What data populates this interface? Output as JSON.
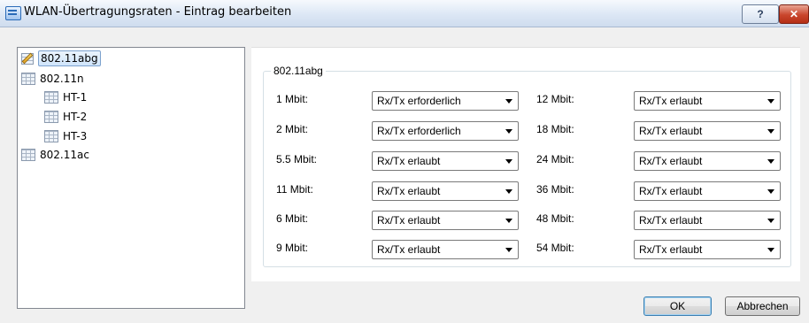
{
  "window": {
    "title": "WLAN-Übertragungsraten - Eintrag bearbeiten",
    "help_label": "?",
    "close_label": "✕"
  },
  "tree": {
    "items": [
      {
        "label": "802.11abg",
        "selected": true
      },
      {
        "label": "802.11n"
      },
      {
        "label": "HT-1"
      },
      {
        "label": "HT-2"
      },
      {
        "label": "HT-3"
      },
      {
        "label": "802.11ac"
      }
    ]
  },
  "group": {
    "title": "802.11abg"
  },
  "rates": {
    "left": [
      {
        "label": "1 Mbit:",
        "value": "Rx/Tx erforderlich"
      },
      {
        "label": "2 Mbit:",
        "value": "Rx/Tx erforderlich"
      },
      {
        "label": "5.5 Mbit:",
        "value": "Rx/Tx erlaubt"
      },
      {
        "label": "11 Mbit:",
        "value": "Rx/Tx erlaubt"
      },
      {
        "label": "6 Mbit:",
        "value": "Rx/Tx erlaubt"
      },
      {
        "label": "9 Mbit:",
        "value": "Rx/Tx erlaubt"
      }
    ],
    "right": [
      {
        "label": "12 Mbit:",
        "value": "Rx/Tx erlaubt"
      },
      {
        "label": "18 Mbit:",
        "value": "Rx/Tx erlaubt"
      },
      {
        "label": "24 Mbit:",
        "value": "Rx/Tx erlaubt"
      },
      {
        "label": "36 Mbit:",
        "value": "Rx/Tx erlaubt"
      },
      {
        "label": "48 Mbit:",
        "value": "Rx/Tx erlaubt"
      },
      {
        "label": "54 Mbit:",
        "value": "Rx/Tx erlaubt"
      }
    ]
  },
  "buttons": {
    "ok": "OK",
    "cancel": "Abbrechen"
  }
}
